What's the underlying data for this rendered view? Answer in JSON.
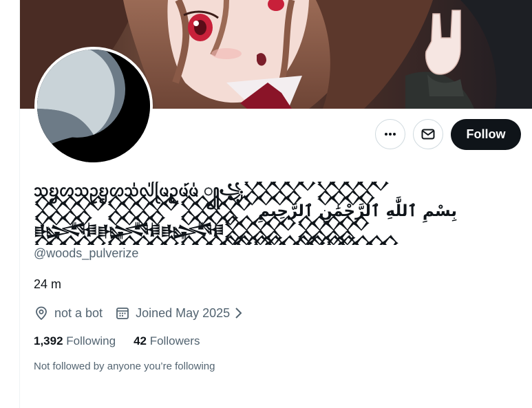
{
  "profile": {
    "display_name": "ᩈᨮᩉᩈᩏᨮᩉᩈ᩵ᩓ᩵ᩕᨾᩏᩬᨾ᩶ᨾ᩵ ꧀꧁𒐫𒐫𒐫𒐫𒐫 بِسْمِ ٱللَّٰهِ ٱلرَّحْمَٰنِ ٱلرَّحِيمِ 𒈙𒈙𒈙𒐫𒐫𒐫𒐫𒐫𒐫𒐫𒐫𒐫𒐫𒐫𒐫𒐫𒐫𒐫𒐫𒐫𒐫𒐫𒐫𒐫𒐫𒐫𒐫𒐫𒐫𒐫𒐫𒐫𒐫𒐫𒐫ᩈᨮᩉ",
    "handle": "@woods_pulverize",
    "bio": "24 m",
    "location": "not a bot",
    "joined": "Joined May 2025",
    "following_count": "1,392",
    "following_label": "Following",
    "followers_count": "42",
    "followers_label": "Followers",
    "not_followed_text": "Not followed by anyone you’re following"
  },
  "actions": {
    "more_icon": "more-dots-icon",
    "message_icon": "mail-icon",
    "follow_label": "Follow"
  },
  "icons": {
    "location": "location-pin-icon",
    "calendar": "calendar-icon",
    "chevron": "chevron-right-icon"
  },
  "colors": {
    "text_primary": "#0f1419",
    "text_secondary": "#536471",
    "border": "#cfd9de",
    "follow_bg": "#0f1419",
    "avatar_gray": "#c9d3d8",
    "avatar_dark_gray": "#6d7b87"
  }
}
